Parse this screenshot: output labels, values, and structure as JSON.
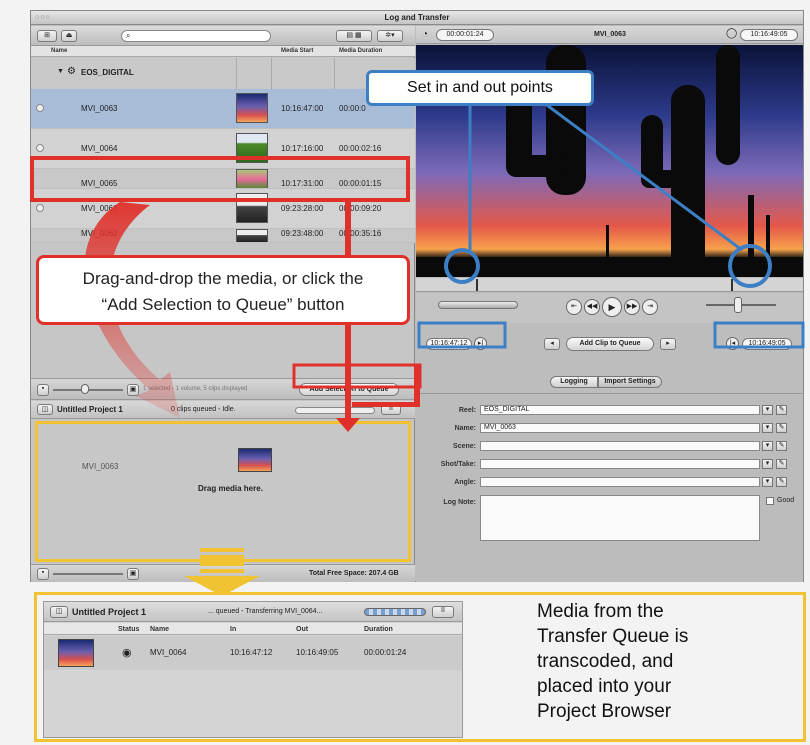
{
  "window": {
    "title": "Log and Transfer"
  },
  "browser": {
    "search_placeholder": "",
    "columns": {
      "name": "Name",
      "media_start": "Media Start",
      "media_duration": "Media Duration"
    },
    "group": "EOS_DIGITAL",
    "clips": [
      {
        "name": "MVI_0063",
        "start": "10:16:47:00",
        "duration": "00:00:0"
      },
      {
        "name": "MVI_0064",
        "start": "10:17:16:00",
        "duration": "00:00:02:16"
      },
      {
        "name": "MVI_0065",
        "start": "10:17:31:00",
        "duration": "00:00:01:15"
      },
      {
        "name": "MVI_0061",
        "start": "09:23:28:00",
        "duration": "00:00:09:20"
      },
      {
        "name": "MVI_0062",
        "start": "09:23:48:00",
        "duration": "00:00:35:16"
      }
    ],
    "status": "1 selected - 1 volume, 5 clips displayed",
    "add_selection_button": "Add Selection to Queue"
  },
  "queue": {
    "project": "Untitled Project 1",
    "status": "0 clips queued - Idle.",
    "pause_label": "II",
    "clip_name": "MVI_0063",
    "drag_hint": "Drag media here.",
    "free_space": "Total Free Space: 207.4 GB"
  },
  "viewer": {
    "timecode_top_left": "00:00:01:24",
    "clip_title": "MVI_0063",
    "timecode_top_right": "10:16:49:05",
    "in_point": "10:16:47:12",
    "out_point": "10:16:49:05",
    "add_clip_button": "Add Clip to Queue",
    "tabs": [
      "Logging",
      "Import Settings"
    ]
  },
  "logging": {
    "fields": [
      {
        "label": "Reel:",
        "value": "EOS_DIGITAL"
      },
      {
        "label": "Name:",
        "value": "MVI_0063"
      },
      {
        "label": "Scene:",
        "value": ""
      },
      {
        "label": "Shot/Take:",
        "value": ""
      },
      {
        "label": "Angle:",
        "value": ""
      }
    ],
    "log_note_label": "Log Note:",
    "good_label": "Good"
  },
  "callouts": {
    "set_points": "Set in and out points",
    "drag_drop_line1": "Drag-and-drop the media, or click the",
    "drag_drop_line2": "“Add Selection to Queue” button",
    "media_note": [
      "Media from the",
      "Transfer Queue is",
      "transcoded, and",
      "placed into your",
      "Project Browser"
    ]
  },
  "project_browser": {
    "project": "Untitled Project 1",
    "status": "... queued - Transferring MVI_0064...",
    "pause_label": "II",
    "columns": [
      "Status",
      "Name",
      "In",
      "Out",
      "Duration"
    ],
    "row": {
      "name": "MVI_0064",
      "in": "10:16:47:12",
      "out": "10:16:49:05",
      "duration": "00:00:01:24"
    }
  },
  "colors": {
    "callout_blue": "#3d7fc4",
    "callout_red": "#e0302a",
    "highlight_yellow": "#f1c232"
  }
}
